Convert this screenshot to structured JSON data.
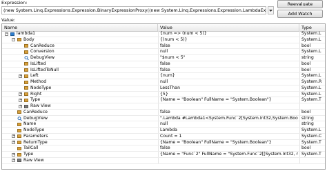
{
  "expression_label": "Expression:",
  "expression_value": "(new System.Linq.Expressions.Expression.BinaryExpressionProxy((new System.Linq.Expressions.Expression.LambdaExpressionProxy(lambda1)).Bo",
  "reevaluate_button": "Reevaluate",
  "add_watch_button": "Add Watch",
  "value_label": "Value:",
  "columns": {
    "name": "Name",
    "value": "Value",
    "type": "Type"
  },
  "rows": [
    {
      "name": "lambda1",
      "value": "{num => (num < 5)}",
      "type": "System.L",
      "depth": 0,
      "expander": "-",
      "icon": "field"
    },
    {
      "name": "Body",
      "value": "{(num < 5)}",
      "type": "System.L",
      "depth": 1,
      "expander": "-",
      "icon": "prop"
    },
    {
      "name": "CanReduce",
      "value": "false",
      "type": "bool",
      "depth": 2,
      "expander": "",
      "icon": "prop"
    },
    {
      "name": "Conversion",
      "value": "null",
      "type": "System.L",
      "depth": 2,
      "expander": "",
      "icon": "prop"
    },
    {
      "name": "DebugView",
      "value": "\"$num < 5\"",
      "type": "string",
      "depth": 2,
      "expander": "",
      "icon": "mag"
    },
    {
      "name": "IsLifted",
      "value": "false",
      "type": "bool",
      "depth": 2,
      "expander": "",
      "icon": "prop"
    },
    {
      "name": "IsLiftedToNull",
      "value": "false",
      "type": "bool",
      "depth": 2,
      "expander": "",
      "icon": "prop"
    },
    {
      "name": "Left",
      "value": "{num}",
      "type": "System.L",
      "depth": 2,
      "expander": "+",
      "icon": "prop"
    },
    {
      "name": "Method",
      "value": "null",
      "type": "System.R",
      "depth": 2,
      "expander": "",
      "icon": "prop"
    },
    {
      "name": "NodeType",
      "value": "LessThan",
      "type": "System.L",
      "depth": 2,
      "expander": "",
      "icon": "prop"
    },
    {
      "name": "Right",
      "value": "{5}",
      "type": "System.L",
      "depth": 2,
      "expander": "+",
      "icon": "prop"
    },
    {
      "name": "Type",
      "value": "{Name = \"Boolean\" FullName = \"System.Boolean\"}",
      "type": "System.T",
      "depth": 2,
      "expander": "+",
      "icon": "prop"
    },
    {
      "name": "Raw View",
      "value": "",
      "type": "",
      "depth": 2,
      "expander": "+",
      "icon": "raw"
    },
    {
      "name": "CanReduce",
      "value": "false",
      "type": "bool",
      "depth": 1,
      "expander": "",
      "icon": "prop"
    },
    {
      "name": "DebugView",
      "value": "\".Lambda #Lambda1<System.Func`2[System.Int32,System.Boolean]>(Syst",
      "type": "string",
      "depth": 1,
      "expander": "",
      "icon": "mag"
    },
    {
      "name": "Name",
      "value": "null",
      "type": "string",
      "depth": 1,
      "expander": "",
      "icon": "prop"
    },
    {
      "name": "NodeType",
      "value": "Lambda",
      "type": "System.L",
      "depth": 1,
      "expander": "",
      "icon": "prop"
    },
    {
      "name": "Parameters",
      "value": "Count = 1",
      "type": "System.C",
      "depth": 1,
      "expander": "+",
      "icon": "prop"
    },
    {
      "name": "ReturnType",
      "value": "{Name = \"Boolean\" FullName = \"System.Boolean\"}",
      "type": "System.T",
      "depth": 1,
      "expander": "+",
      "icon": "prop"
    },
    {
      "name": "TailCall",
      "value": "false",
      "type": "bool",
      "depth": 1,
      "expander": "",
      "icon": "prop"
    },
    {
      "name": "Type",
      "value": "{Name = \"Func`2\" FullName = \"System.Func`2[[System.Int32, mscorlib, Version",
      "type": "System.T",
      "depth": 1,
      "expander": "+",
      "icon": "prop"
    },
    {
      "name": "Raw View",
      "value": "",
      "type": "",
      "depth": 1,
      "expander": "+",
      "icon": "raw"
    }
  ]
}
